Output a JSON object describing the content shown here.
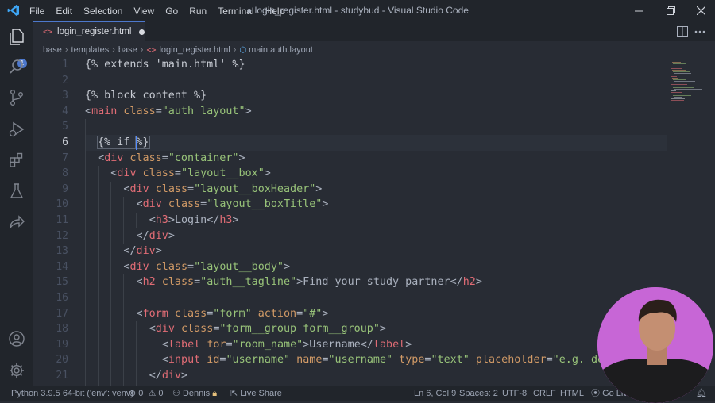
{
  "titlebar": {
    "menu": [
      "File",
      "Edit",
      "Selection",
      "View",
      "Go",
      "Run",
      "Terminal",
      "Help"
    ],
    "window_title": "● login_register.html - studybud - Visual Studio Code"
  },
  "activity": {
    "explorer_badge": "1"
  },
  "tab": {
    "label": "login_register.html"
  },
  "breadcrumb": {
    "items": [
      "base",
      "templates",
      "base",
      "login_register.html",
      "main.auth.layout"
    ]
  },
  "editor": {
    "line_numbers": [
      "1",
      "2",
      "3",
      "4",
      "5",
      "6",
      "7",
      "8",
      "9",
      "10",
      "11",
      "12",
      "13",
      "14",
      "15",
      "16",
      "17",
      "18",
      "19",
      "20",
      "21"
    ]
  },
  "code": {
    "l1": "{% extends 'main.html' %}",
    "l3": "{% block content %}",
    "l4_open": "<",
    "l4_tag": "main",
    "l4_attr": " class",
    "l4_eq": "=",
    "l4_str": "\"auth layout\"",
    "l4_close": ">",
    "l6_a": "{% if ",
    "l6_b": "%}",
    "l7": [
      "<",
      "div",
      " class",
      "=",
      "\"container\"",
      ">"
    ],
    "l8": [
      "<",
      "div",
      " class",
      "=",
      "\"layout__box\"",
      ">"
    ],
    "l9": [
      "<",
      "div",
      " class",
      "=",
      "\"layout__boxHeader\"",
      ">"
    ],
    "l10": [
      "<",
      "div",
      " class",
      "=",
      "\"layout__boxTitle\"",
      ">"
    ],
    "l11": [
      "<",
      "h3",
      ">",
      "Login",
      "</",
      "h3",
      ">"
    ],
    "l12": [
      "</",
      "div",
      ">"
    ],
    "l13": [
      "</",
      "div",
      ">"
    ],
    "l14": [
      "<",
      "div",
      " class",
      "=",
      "\"layout__body\"",
      ">"
    ],
    "l15": [
      "<",
      "h2",
      " class",
      "=",
      "\"auth__tagline\"",
      ">",
      "Find your study partner",
      "</",
      "h2",
      ">"
    ],
    "l17": [
      "<",
      "form",
      " class",
      "=",
      "\"form\"",
      " action",
      "=",
      "\"#\"",
      ">"
    ],
    "l18": [
      "<",
      "div",
      " class",
      "=",
      "\"form__group form__group\"",
      ">"
    ],
    "l19": [
      "<",
      "label",
      " for",
      "=",
      "\"room_name\"",
      ">",
      "Username",
      "</",
      "label",
      ">"
    ],
    "l20": [
      "<",
      "input",
      " id",
      "=",
      "\"username\"",
      " name",
      "=",
      "\"username\"",
      " type",
      "=",
      "\"text\"",
      " placeholder",
      "=",
      "\"e.g. de"
    ],
    "l21": [
      "</",
      "div",
      ">"
    ]
  },
  "statusbar": {
    "python": "Python 3.9.5 64-bit ('env': venv)",
    "errors": "0",
    "warnings": "0",
    "user": "Dennis",
    "liveshare": "Live Share",
    "position": "Ln 6, Col 9",
    "spaces": "Spaces: 2",
    "encoding": "UTF-8",
    "eol": "CRLF",
    "language": "HTML",
    "golive": "Go Live"
  },
  "colors": {
    "accent": "#4d78cc",
    "tag": "#e06c75",
    "attr": "#d19a66",
    "string": "#98c379",
    "background": "#282c34",
    "chrome": "#21252b"
  }
}
